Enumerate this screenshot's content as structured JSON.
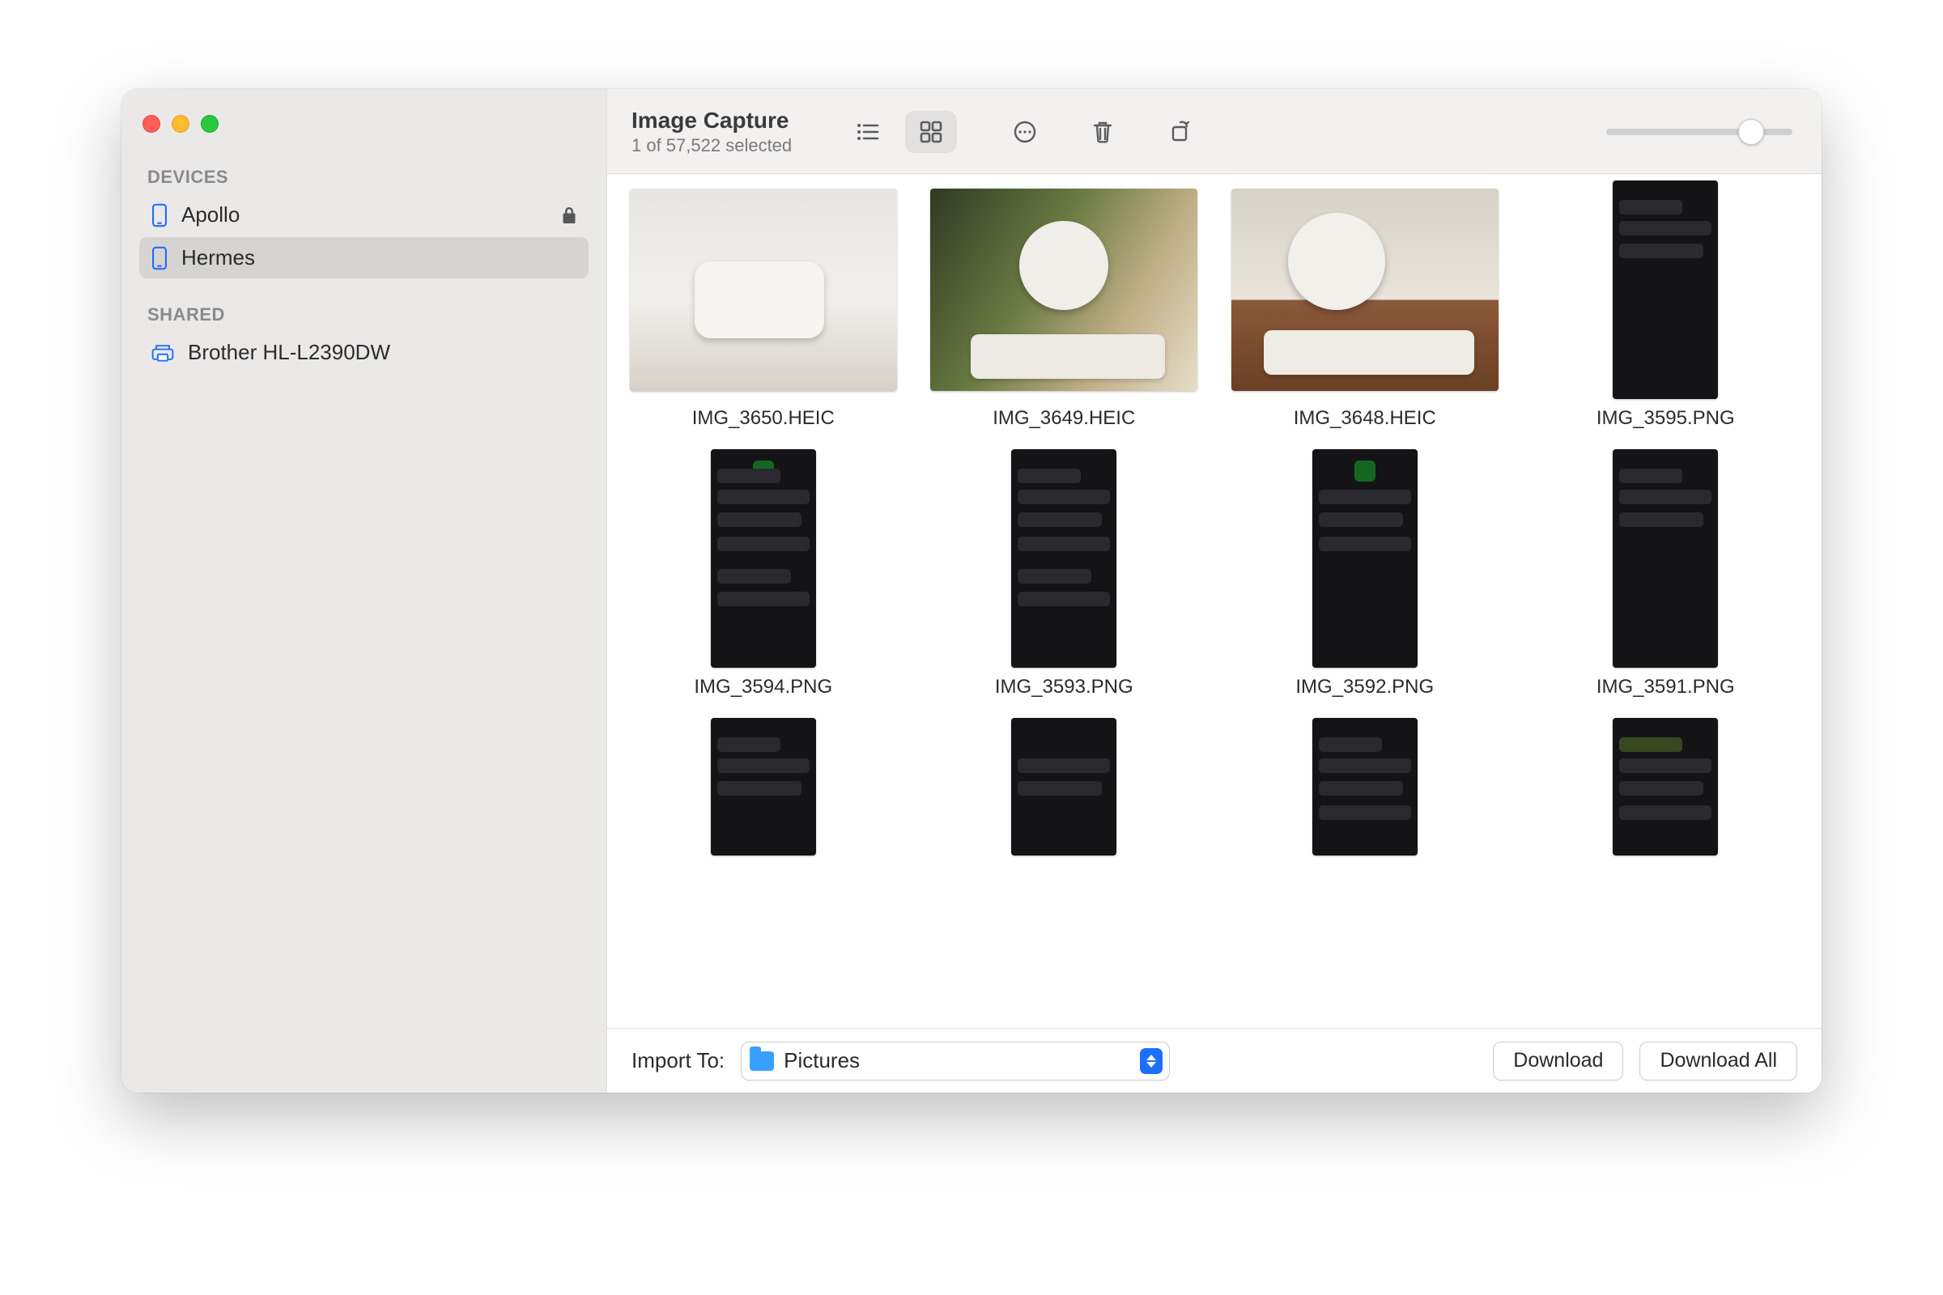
{
  "header": {
    "title": "Image Capture",
    "subtitle": "1 of 57,522 selected"
  },
  "toolbar": {
    "view_mode": "grid",
    "thumbnail_size_percent": 78
  },
  "sidebar": {
    "sections": [
      {
        "label": "DEVICES",
        "items": [
          {
            "name": "Apollo",
            "icon": "phone-icon",
            "locked": true,
            "selected": false
          },
          {
            "name": "Hermes",
            "icon": "phone-icon",
            "locked": false,
            "selected": true
          }
        ]
      },
      {
        "label": "SHARED",
        "items": [
          {
            "name": "Brother HL-L2390DW",
            "icon": "scanner-icon",
            "selected": false
          }
        ]
      }
    ]
  },
  "grid": {
    "items": [
      {
        "filename": "IMG_3650.HEIC",
        "orientation": "landscape"
      },
      {
        "filename": "IMG_3649.HEIC",
        "orientation": "landscape"
      },
      {
        "filename": "IMG_3648.HEIC",
        "orientation": "landscape"
      },
      {
        "filename": "IMG_3595.PNG",
        "orientation": "portrait"
      },
      {
        "filename": "IMG_3594.PNG",
        "orientation": "portrait"
      },
      {
        "filename": "IMG_3593.PNG",
        "orientation": "portrait"
      },
      {
        "filename": "IMG_3592.PNG",
        "orientation": "portrait"
      },
      {
        "filename": "IMG_3591.PNG",
        "orientation": "portrait"
      }
    ]
  },
  "footer": {
    "import_label": "Import To:",
    "destination": "Pictures",
    "download_label": "Download",
    "download_all_label": "Download All"
  }
}
